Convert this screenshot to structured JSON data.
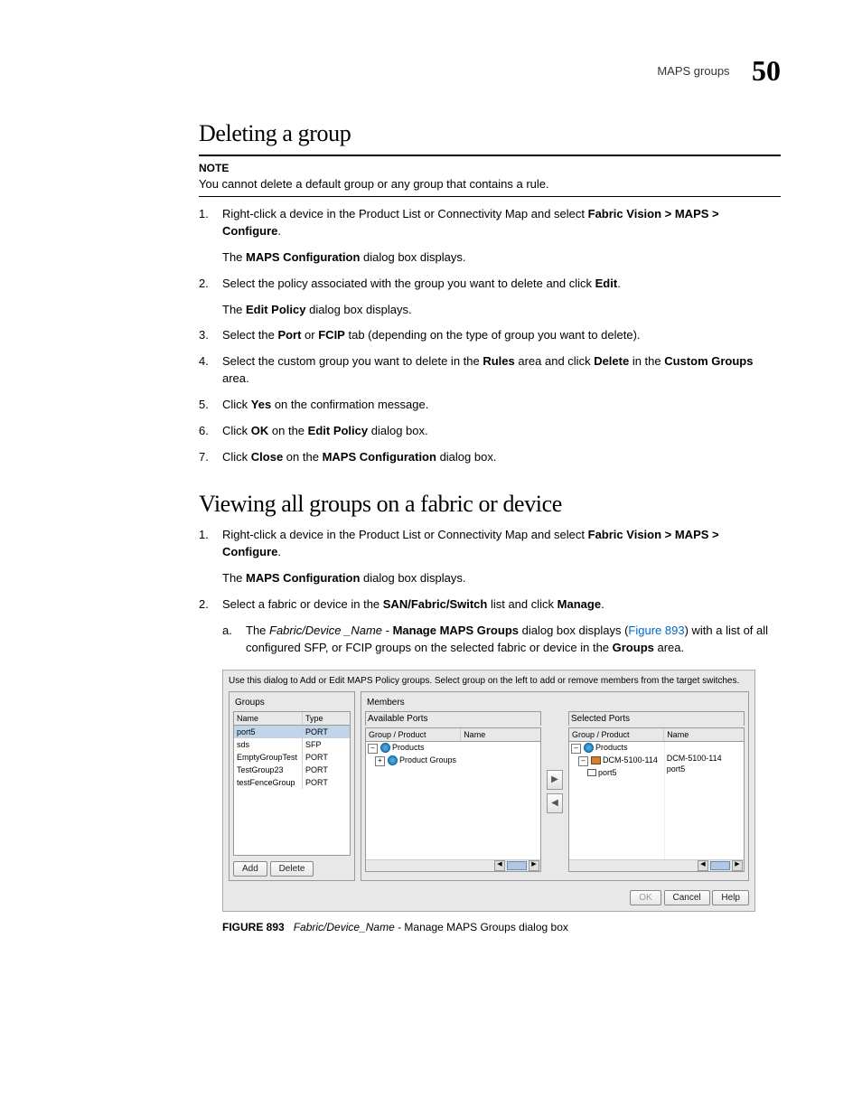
{
  "header": {
    "breadcrumb": "MAPS groups",
    "chapter": "50"
  },
  "s1": {
    "title": "Deleting a group",
    "noteLabel": "NOTE",
    "noteText": "You cannot delete a default group or any group that contains a rule.",
    "steps": {
      "s1a": "Right-click a device in the Product List or Connectivity Map and select ",
      "s1b": "Fabric Vision > MAPS > Configure",
      "s1c": ".",
      "s1sub_a": "The ",
      "s1sub_b": "MAPS Configuration",
      "s1sub_c": " dialog box displays.",
      "s2a": "Select the policy associated with the group you want to delete and click ",
      "s2b": "Edit",
      "s2c": ".",
      "s2sub_a": "The ",
      "s2sub_b": "Edit Policy",
      "s2sub_c": " dialog box displays.",
      "s3a": "Select the ",
      "s3b": "Port",
      "s3c": " or ",
      "s3d": "FCIP",
      "s3e": " tab (depending on the type of group you want to delete).",
      "s4a": "Select the custom group you want to delete in the ",
      "s4b": "Rules",
      "s4c": " area and click ",
      "s4d": "Delete",
      "s4e": " in the ",
      "s4f": "Custom Groups",
      "s4g": " area.",
      "s5a": "Click ",
      "s5b": "Yes",
      "s5c": " on the confirmation message.",
      "s6a": "Click ",
      "s6b": "OK",
      "s6c": " on the ",
      "s6d": "Edit Policy",
      "s6e": " dialog box.",
      "s7a": "Click ",
      "s7b": "Close",
      "s7c": " on the ",
      "s7d": "MAPS Configuration",
      "s7e": " dialog box."
    }
  },
  "s2": {
    "title": "Viewing all groups on a fabric or device",
    "steps": {
      "s1a": "Right-click a device in the Product List or Connectivity Map and select ",
      "s1b": "Fabric Vision > MAPS > Configure",
      "s1c": ".",
      "s1sub_a": "The ",
      "s1sub_b": "MAPS Configuration",
      "s1sub_c": " dialog box displays.",
      "s2a": "Select a fabric or device in the ",
      "s2b": "SAN/Fabric/Switch",
      "s2c": " list and click ",
      "s2d": "Manage",
      "s2e": ".",
      "suba1": "The ",
      "suba2": "Fabric/Device _Name",
      "suba3": " - ",
      "suba4": "Manage MAPS Groups",
      "suba5": " dialog box displays (",
      "suba6": "Figure 893",
      "suba7": ") with a list of all configured SFP, or FCIP groups on the selected fabric or device in the ",
      "suba8": "Groups",
      "suba9": " area."
    }
  },
  "figure": {
    "instruction": "Use this dialog to Add or Edit MAPS Policy groups. Select group on the left to add or remove members from the target switches.",
    "groupsTitle": "Groups",
    "membersTitle": "Members",
    "availTitle": "Available Ports",
    "selTitle": "Selected Ports",
    "colName": "Name",
    "colType": "Type",
    "colGP": "Group / Product",
    "groupRows": [
      {
        "name": "port5",
        "type": "PORT"
      },
      {
        "name": "sds",
        "type": "SFP"
      },
      {
        "name": "EmptyGroupTest",
        "type": "PORT"
      },
      {
        "name": "TestGroup23",
        "type": "PORT"
      },
      {
        "name": "testFenceGroup",
        "type": "PORT"
      }
    ],
    "availTree": {
      "root": "Products",
      "child": "Product Groups"
    },
    "selTree": {
      "root": "Products",
      "device": "DCM-5100-114",
      "port": "port5",
      "deviceName": "DCM-5100-114",
      "portName": "port5"
    },
    "btnAdd": "Add",
    "btnDelete": "Delete",
    "btnOK": "OK",
    "btnCancel": "Cancel",
    "btnHelp": "Help"
  },
  "caption": {
    "label": "FIGURE 893",
    "italic": "Fabric/Device_Name",
    "rest": " - Manage MAPS Groups dialog box"
  }
}
